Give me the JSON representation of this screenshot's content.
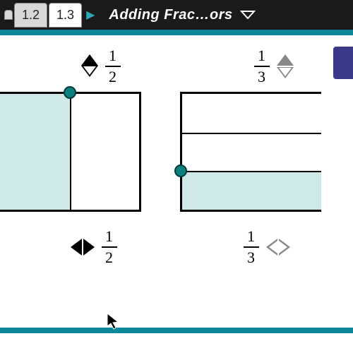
{
  "tabs": {
    "prev2": "",
    "prev": "1.2",
    "current": "1.3"
  },
  "title": "Adding Frac…ors",
  "left": {
    "top": {
      "num": "1",
      "den": "2"
    },
    "bottom": {
      "num": "1",
      "den": "2"
    }
  },
  "right": {
    "top": {
      "num": "1",
      "den": "3"
    },
    "bottom": {
      "num": "1",
      "den": "3"
    }
  }
}
